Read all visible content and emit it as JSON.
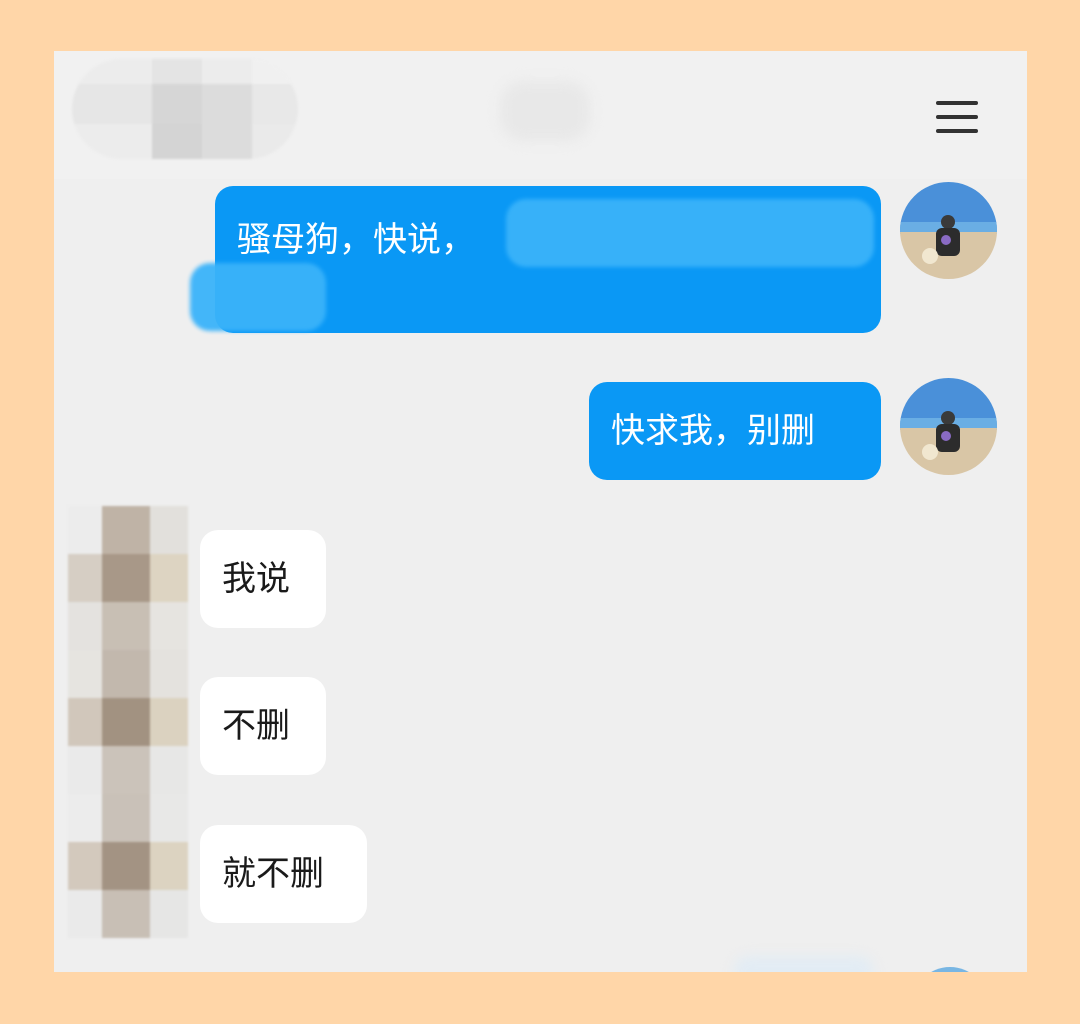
{
  "header": {
    "menu_icon": "hamburger-menu-icon"
  },
  "messages": [
    {
      "side": "outgoing",
      "text_visible": "骚母狗，快说，",
      "has_redacted_content": true
    },
    {
      "side": "outgoing",
      "text": "快求我，别删"
    },
    {
      "side": "incoming",
      "text": "我说"
    },
    {
      "side": "incoming",
      "text": "不删"
    },
    {
      "side": "incoming",
      "text": "就不删"
    }
  ],
  "colors": {
    "page_border": "#ffd6a8",
    "chat_background": "#efefef",
    "outgoing_bubble": "#0a98f5",
    "incoming_bubble": "#ffffff"
  },
  "avatar_icons": {
    "self": "beach-photo-avatar",
    "other": "pixelated-avatar"
  }
}
